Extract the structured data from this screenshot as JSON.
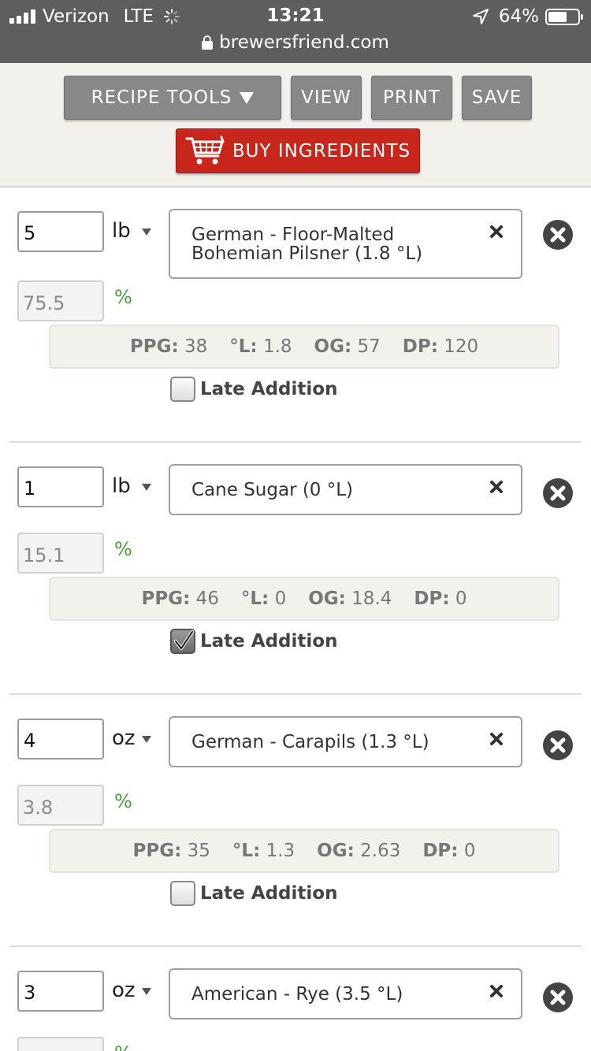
{
  "status_bar": {
    "carrier": "Verizon",
    "network": "LTE",
    "time": "13:21",
    "battery": "64%",
    "battery_level": 0.64,
    "url": "brewersfriend.com"
  },
  "toolbar": {
    "recipe_tools": "RECIPE TOOLS",
    "view": "VIEW",
    "print": "PRINT",
    "save": "SAVE",
    "buy_ingredients": "BUY INGREDIENTS"
  },
  "labels": {
    "ppg": "PPG:",
    "lovibond": "°L:",
    "og": "OG:",
    "dp": "DP:",
    "late_addition": "Late Addition",
    "percent": "%"
  },
  "colors": {
    "buy_button": "#c8251d",
    "toolbar_button": "#888888",
    "percent_sign": "#4a9a3a"
  },
  "ingredients": [
    {
      "amount": "5",
      "unit": "lb",
      "name": "German - Floor-Malted Bohemian Pilsner (1.8 °L)",
      "percent": "75.5",
      "ppg": "38",
      "lovibond": "1.8",
      "og": "57",
      "dp": "120",
      "late_addition": false
    },
    {
      "amount": "1",
      "unit": "lb",
      "name": "Cane Sugar (0 °L)",
      "percent": "15.1",
      "ppg": "46",
      "lovibond": "0",
      "og": "18.4",
      "dp": "0",
      "late_addition": true
    },
    {
      "amount": "4",
      "unit": "oz",
      "name": "German - Carapils (1.3 °L)",
      "percent": "3.8",
      "ppg": "35",
      "lovibond": "1.3",
      "og": "2.63",
      "dp": "0",
      "late_addition": false
    },
    {
      "amount": "3",
      "unit": "oz",
      "name": "American - Rye (3.5 °L)",
      "percent": "",
      "ppg": "",
      "lovibond": "",
      "og": "",
      "dp": "",
      "late_addition": false
    }
  ]
}
